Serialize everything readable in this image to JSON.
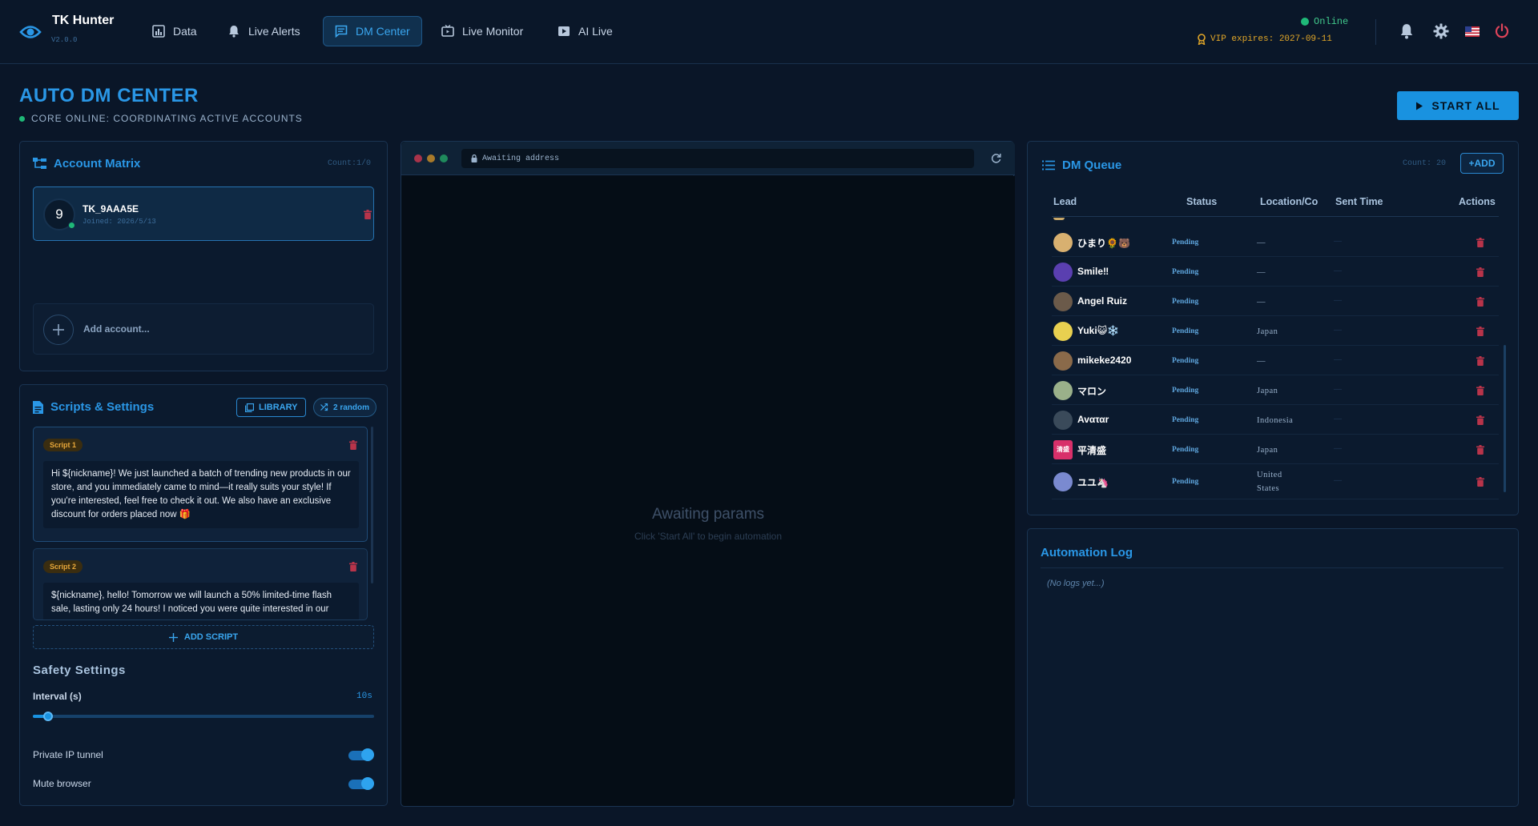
{
  "brand": {
    "title": "TK Hunter",
    "version": "V2.0.0"
  },
  "nav": [
    {
      "label": "Data",
      "icon": "bar-chart-icon"
    },
    {
      "label": "Live Alerts",
      "icon": "bell-icon"
    },
    {
      "label": "DM Center",
      "icon": "message-icon",
      "active": true
    },
    {
      "label": "Live Monitor",
      "icon": "tv-icon"
    },
    {
      "label": "AI Live",
      "icon": "play-icon"
    }
  ],
  "status": {
    "online": "Online",
    "vip": "VIP expires: 2027-09-11"
  },
  "header": {
    "title": "AUTO DM CENTER",
    "subtitle": "CORE ONLINE: COORDINATING ACTIVE ACCOUNTS",
    "start_all": "START ALL"
  },
  "accounts": {
    "title": "Account Matrix",
    "count": "Count:1/0",
    "items": [
      {
        "avatar": "9",
        "name": "TK_9AAA5E",
        "joined": "Joined: 2026/5/13"
      }
    ],
    "add_label": "Add account..."
  },
  "scripts": {
    "title": "Scripts & Settings",
    "library": "LIBRARY",
    "random": "2 random",
    "items": [
      {
        "badge": "Script 1",
        "text": "Hi ${nickname}! We just launched a batch of trending new products in our store, and you immediately came to mind—it really suits your style! If you're interested, feel free to check it out. We also have an exclusive discount for orders placed now 🎁"
      },
      {
        "badge": "Script 2",
        "text": "${nickname}, hello! Tomorrow we will launch a 50% limited-time flash sale, lasting only 24 hours! I noticed you were quite interested in our"
      }
    ],
    "add_script": "ADD SCRIPT"
  },
  "safety": {
    "title": "Safety Settings",
    "interval_label": "Interval (s)",
    "interval_value": "10s",
    "interval_fraction": 0.045,
    "private_ip": "Private IP tunnel",
    "mute": "Mute browser",
    "private_ip_on": true,
    "mute_on": true
  },
  "browser": {
    "address": "Awaiting address",
    "title": "Awaiting params",
    "subtitle": "Click 'Start All' to begin automation"
  },
  "queue": {
    "title": "DM Queue",
    "count": "Count: 20",
    "add": "+ADD",
    "columns": [
      "Lead",
      "Status",
      "Location/Co",
      "Sent Time",
      "Actions"
    ],
    "rows": [
      {
        "name": "ひまり🌻🐻",
        "status": "Pending",
        "location": "—",
        "sent": "—",
        "avatar_color": "#d8b070"
      },
      {
        "name": "Smile‼",
        "status": "Pending",
        "location": "—",
        "sent": "—",
        "avatar_color": "#5a3fb0"
      },
      {
        "name": "Angel Ruiz",
        "status": "Pending",
        "location": "—",
        "sent": "—",
        "avatar_color": "#6b5a4a"
      },
      {
        "name": "Yuki😺❄️",
        "status": "Pending",
        "location": "Japan",
        "sent": "—",
        "avatar_color": "#e8d050"
      },
      {
        "name": "mikeke2420",
        "status": "Pending",
        "location": "—",
        "sent": "—",
        "avatar_color": "#8a6a4a"
      },
      {
        "name": "マロン",
        "status": "Pending",
        "location": "Japan",
        "sent": "—",
        "avatar_color": "#9ab08a"
      },
      {
        "name": "Avαταr",
        "status": "Pending",
        "location": "Indonesia",
        "sent": "—",
        "avatar_color": "#3a4a5a"
      },
      {
        "name": "平清盛",
        "status": "Pending",
        "location": "Japan",
        "sent": "—",
        "avatar_color": "#d8306a",
        "avatar_text": "清盛"
      },
      {
        "name": "ユユ🦄",
        "status": "Pending",
        "location": "United States",
        "sent": "—",
        "avatar_color": "#7a8ad0"
      }
    ]
  },
  "log": {
    "title": "Automation Log",
    "empty": "(No logs yet...)"
  },
  "colors": {
    "accent": "#2a97e6",
    "background": "#0a1628",
    "online": "#1fb978",
    "vip": "#e2a728",
    "danger": "#e0445a"
  }
}
